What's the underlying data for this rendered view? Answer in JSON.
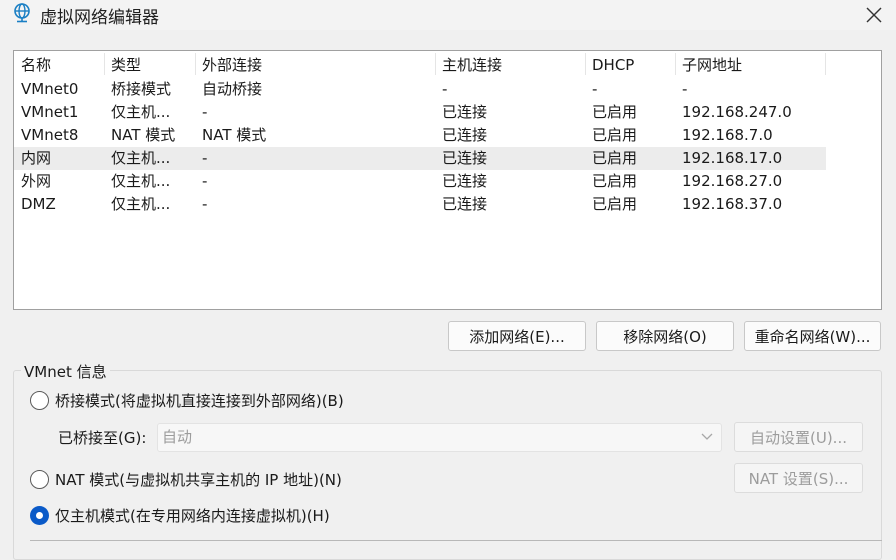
{
  "window": {
    "title": "虚拟网络编辑器",
    "app_icon": "network-globe-icon",
    "close_icon": "close-icon"
  },
  "table": {
    "headers": [
      "名称",
      "类型",
      "外部连接",
      "主机连接",
      "DHCP",
      "子网地址"
    ],
    "rows": [
      [
        "VMnet0",
        "桥接模式",
        "自动桥接",
        "-",
        "-",
        "-"
      ],
      [
        "VMnet1",
        "仅主机...",
        "-",
        "已连接",
        "已启用",
        "192.168.247.0"
      ],
      [
        "VMnet8",
        "NAT 模式",
        "NAT 模式",
        "已连接",
        "已启用",
        "192.168.7.0"
      ],
      [
        "内网",
        "仅主机...",
        "-",
        "已连接",
        "已启用",
        "192.168.17.0"
      ],
      [
        "外网",
        "仅主机...",
        "-",
        "已连接",
        "已启用",
        "192.168.27.0"
      ],
      [
        "DMZ",
        "仅主机...",
        "-",
        "已连接",
        "已启用",
        "192.168.37.0"
      ]
    ],
    "selected_row": 3
  },
  "buttons": {
    "add": "添加网络(E)...",
    "remove": "移除网络(O)",
    "rename": "重命名网络(W)..."
  },
  "vmnet_info": {
    "label": "VMnet 信息",
    "bridge_radio": "桥接模式(将虚拟机直接连接到外部网络)(B)",
    "bridged_to_label": "已桥接至(G):",
    "bridged_to_value": "自动",
    "auto_settings": "自动设置(U)...",
    "nat_radio": "NAT 模式(与虚拟机共享主机的 IP 地址)(N)",
    "nat_settings": "NAT 设置(S)...",
    "host_only_radio": "仅主机模式(在专用网络内连接虚拟机)(H)",
    "selected_mode": "host-only"
  },
  "colors": {
    "radio_accent": "#0a5ac8",
    "selected_row": "#ececec"
  }
}
